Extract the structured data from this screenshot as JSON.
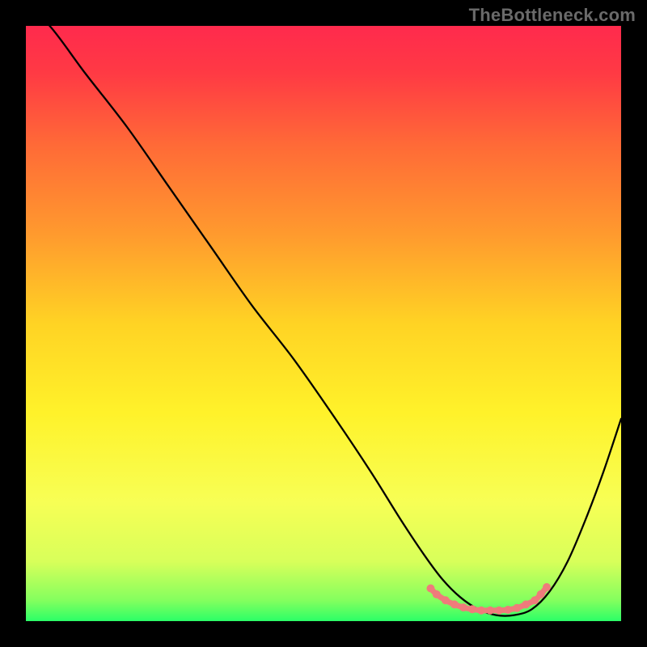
{
  "watermark": "TheBottleneck.com",
  "chart_data": {
    "type": "line",
    "title": "",
    "xlabel": "",
    "ylabel": "",
    "xlim": [
      0,
      100
    ],
    "ylim": [
      0,
      100
    ],
    "grid": false,
    "legend": false,
    "gradient": {
      "stops": [
        {
          "offset": 0.0,
          "color": "#ff2a4d"
        },
        {
          "offset": 0.08,
          "color": "#ff3a44"
        },
        {
          "offset": 0.2,
          "color": "#ff6a37"
        },
        {
          "offset": 0.35,
          "color": "#ff9a2e"
        },
        {
          "offset": 0.5,
          "color": "#ffd324"
        },
        {
          "offset": 0.65,
          "color": "#fff22a"
        },
        {
          "offset": 0.8,
          "color": "#f7ff55"
        },
        {
          "offset": 0.9,
          "color": "#d8ff5a"
        },
        {
          "offset": 0.965,
          "color": "#84ff5e"
        },
        {
          "offset": 1.0,
          "color": "#2bff67"
        }
      ]
    },
    "series": [
      {
        "name": "bottleneck-curve",
        "x": [
          0,
          4,
          10,
          17,
          24,
          31,
          38,
          45,
          52,
          58,
          63,
          67,
          70,
          73,
          76,
          79,
          82,
          85,
          88,
          91,
          94,
          97,
          100
        ],
        "y": [
          103,
          100,
          92,
          83,
          73,
          63,
          53,
          44,
          34,
          25,
          17,
          11,
          7,
          4,
          2,
          1,
          1,
          2,
          5,
          10,
          17,
          25,
          34
        ]
      }
    ],
    "highlight": {
      "name": "flat-minimum",
      "color": "#ef7b7b",
      "points": [
        {
          "x": 68.0,
          "y": 5.5
        },
        {
          "x": 69.0,
          "y": 4.5
        },
        {
          "x": 70.5,
          "y": 3.5
        },
        {
          "x": 72.0,
          "y": 2.8
        },
        {
          "x": 73.5,
          "y": 2.3
        },
        {
          "x": 75.0,
          "y": 2.0
        },
        {
          "x": 76.5,
          "y": 1.8
        },
        {
          "x": 78.0,
          "y": 1.8
        },
        {
          "x": 79.5,
          "y": 1.8
        },
        {
          "x": 81.0,
          "y": 1.9
        },
        {
          "x": 82.5,
          "y": 2.2
        },
        {
          "x": 84.0,
          "y": 2.8
        },
        {
          "x": 85.5,
          "y": 3.5
        },
        {
          "x": 86.5,
          "y": 4.5
        },
        {
          "x": 87.5,
          "y": 5.7
        }
      ],
      "dot_radius_px": 5,
      "stroke_width_px": 7
    },
    "curve_stroke_width_px": 2.3
  }
}
